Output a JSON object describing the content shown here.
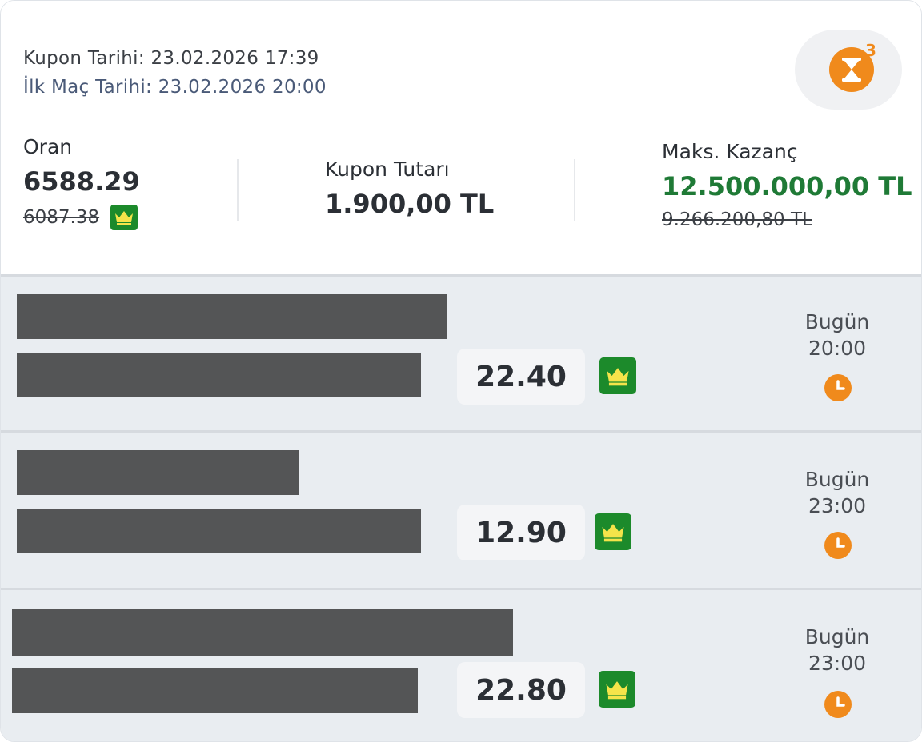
{
  "coupon": {
    "date_line": "Kupon Tarihi: 23.02.2026 17:39",
    "first_match_line": "İlk Maç Tarihi: 23.02.2026 20:00",
    "badge_count": "3"
  },
  "stats": {
    "odds_label": "Oran",
    "odds_value": "6588.29",
    "odds_old": "6087.38",
    "amount_label": "Kupon Tutarı",
    "amount_value": "1.900,00 TL",
    "max_label": "Maks. Kazanç",
    "max_value": "12.500.000,00 TL",
    "max_old": "9.266.200,80 TL"
  },
  "matches": [
    {
      "odds": "22.40",
      "day": "Bugün",
      "time": "20:00"
    },
    {
      "odds": "12.90",
      "day": "Bugün",
      "time": "23:00"
    },
    {
      "odds": "22.80",
      "day": "Bugün",
      "time": "23:00"
    }
  ],
  "colors": {
    "accent_orange": "#f08a1c",
    "win_green": "#1f7a36",
    "crown_green": "#1c8a2b"
  },
  "icons": [
    "hourglass-icon",
    "crown-icon",
    "clock-icon"
  ]
}
